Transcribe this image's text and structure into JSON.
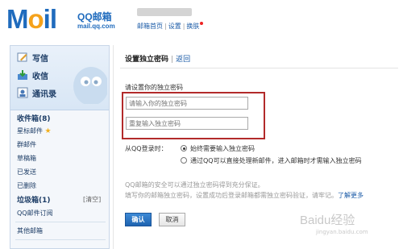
{
  "header": {
    "logo_text_m": "M",
    "logo_text_o": "o",
    "logo_text_il": "il",
    "brand": "QQ邮箱",
    "url": "mail.qq.com",
    "links": {
      "home": "邮箱首页",
      "settings": "设置",
      "skin": "换肤"
    },
    "separator": "|"
  },
  "sidebar": {
    "quick": {
      "write": "写信",
      "receive": "收信",
      "contacts": "通讯录"
    },
    "folders": {
      "inbox": "收件箱(8)",
      "starred": "星标邮件",
      "group": "群邮件",
      "drafts": "草稿箱",
      "sent": "已发送",
      "deleted": "已删除",
      "spam": "垃圾箱(1)",
      "spam_clean": "[清空]",
      "subscribe": "QQ邮件订阅",
      "other": "其他邮箱"
    }
  },
  "main": {
    "title": "设置独立密码",
    "title_sep": "|",
    "back": "返回",
    "prompt": "请设置你的独立密码",
    "password": {
      "placeholder": "请输入你的独立密码"
    },
    "password_confirm": {
      "placeholder": "重复输入独立密码"
    },
    "login_label": "从QQ登录时：",
    "option_always": "始终需要输入独立密码",
    "option_direct": "通过QQ可以直接处理新邮件，进入邮箱时才需输入独立密码",
    "note_line1": "QQ邮箱的安全可以通过独立密码得到充分保证。",
    "note_line2": "填写你的邮箱独立密码，设置成功后登录邮箱都需独立密码验证，请牢记。",
    "learn_more": "了解更多",
    "ok_button": "确认",
    "cancel_button": "取消"
  },
  "watermark": {
    "brand": "Baidu经验",
    "url": "jingyan.baidu.com"
  },
  "colors": {
    "brand_blue": "#1f6bbd",
    "accent_orange": "#f5a21b",
    "highlight_red": "#b22a2a",
    "link_blue": "#1b5ba7"
  }
}
